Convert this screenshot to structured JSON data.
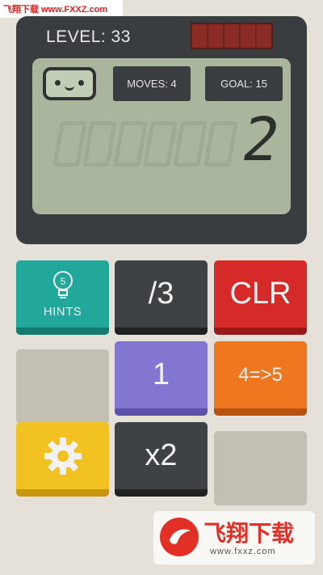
{
  "watermark_top": "飞翔下载 www.FXXZ.com",
  "watermark_bottom": {
    "title": "飞翔下载",
    "url": "www.fxxz.com"
  },
  "header": {
    "level_label": "LEVEL: 33"
  },
  "screen": {
    "moves_label": "MOVES: 4",
    "goal_label": "GOAL: 15",
    "display_value": "2"
  },
  "keys": {
    "hints": {
      "count": "5",
      "label": "HINTS"
    },
    "divide": "/3",
    "clear": "CLR",
    "one": "1",
    "convert": "4=>5",
    "times_two": "x2"
  },
  "icons": [
    "smiley-face-icon",
    "lightbulb-icon",
    "gear-icon",
    "solar-panel-icon"
  ],
  "colors": {
    "teal": "#22a79b",
    "red": "#d62a28",
    "purple": "#8276d1",
    "orange": "#ef771f",
    "yellow": "#f2c122",
    "dark": "#3f4245",
    "lcd": "#a9b59d"
  }
}
